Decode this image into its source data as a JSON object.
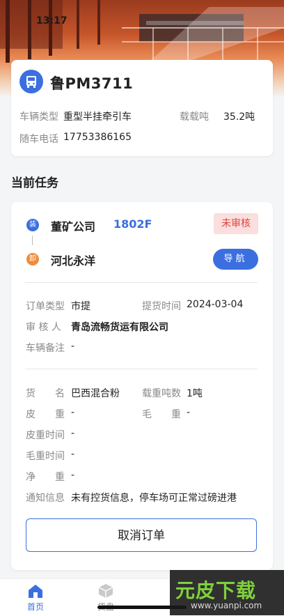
{
  "status_bar": {
    "time": "13:17"
  },
  "vehicle": {
    "plate": "鲁PM3711",
    "type_label": "车辆类型",
    "type_value": "重型半挂牵引车",
    "capacity_label": "载载吨",
    "capacity_value": "35.2吨",
    "phone_label": "随车电话",
    "phone_value": "17753386165"
  },
  "current_task": {
    "title": "当前任务",
    "load_tag": "装",
    "load_company": "董矿公司",
    "order_no": "1802F",
    "status_badge": "未审核",
    "unload_tag": "卸",
    "unload_company": "河北永洋",
    "nav_label": "导航",
    "details": {
      "order_type_label": "订单类型",
      "order_type_value": "市提",
      "pickup_time_label": "提货时间",
      "pickup_time_value": "2024-03-04",
      "reviewer_label": "审 核 人",
      "reviewer_value": "青岛流畅货运有限公司",
      "vehicle_note_label": "车辆备注",
      "vehicle_note_value": "-",
      "goods_label": "货　　名",
      "goods_value": "巴西混合粉",
      "load_weight_label": "载重吨数",
      "load_weight_value": "1吨",
      "tare_label": "皮　　重",
      "tare_value": "-",
      "gross_label": "毛　　重",
      "gross_value": "-",
      "tare_time_label": "皮重时间",
      "tare_time_value": "-",
      "gross_time_label": "毛重时间",
      "gross_time_value": "-",
      "net_label": "净　　重",
      "net_value": "-",
      "notice_label": "通知信息",
      "notice_value": "未有控货信息，停车场可正常过磅进港"
    },
    "cancel_label": "取消订单"
  },
  "tabbar": {
    "home_label": "首页",
    "goods_label": "货盘"
  },
  "watermark": {
    "brand": "元皮下载",
    "url": "www.yuanpi.com"
  },
  "colors": {
    "accent": "#3b6fe0",
    "badge_bg": "#fbdede",
    "badge_text": "#e0443e",
    "load_dot": "#3b6fe0",
    "unload_dot": "#f08c3c"
  }
}
